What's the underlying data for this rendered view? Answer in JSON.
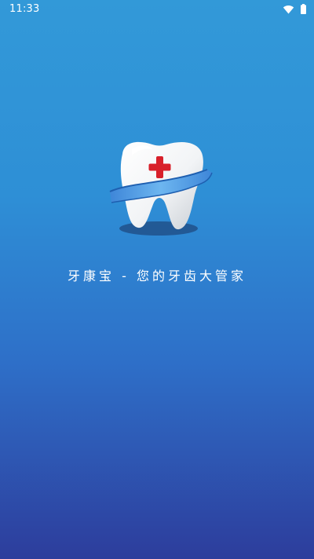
{
  "status_bar": {
    "time": "11:33",
    "icons": [
      "wifi-icon",
      "battery-icon"
    ]
  },
  "splash": {
    "slogan": "牙康宝 - 您的牙齿大管家",
    "logo_icon": "tooth-logo-icon"
  },
  "colors": {
    "background_top": "#3299d8",
    "background_bottom": "#2d3d9c",
    "cross_red": "#d8202a",
    "ribbon_blue": "#5aa8e8"
  }
}
